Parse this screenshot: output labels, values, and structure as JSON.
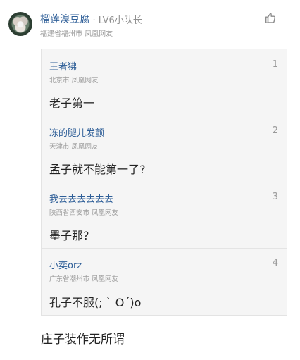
{
  "comment": {
    "username": "榴莲溴豆腐",
    "level": "· LV6小队长",
    "location": "福建省福州市 凤凰网友",
    "reply": "庄子装作无所谓"
  },
  "icons": {
    "avatar": "lotus-avatar",
    "like": "thumbs-up-icon"
  },
  "quotes": [
    {
      "index": "1",
      "name": "王者狒",
      "location": "北京市 凤凰网友",
      "text": "老子第一"
    },
    {
      "index": "2",
      "name": "冻的腿儿发颤",
      "location": "天津市 凤凰网友",
      "text": "孟子就不能第一了?"
    },
    {
      "index": "3",
      "name": "我去去去去去去",
      "location": "陕西省西安市 凤凰网友",
      "text": "墨子那?"
    },
    {
      "index": "4",
      "name": "小奕orz",
      "location": "广东省潮州市 凤凰网友",
      "text": "孔子不服(; ` O´)o"
    }
  ]
}
